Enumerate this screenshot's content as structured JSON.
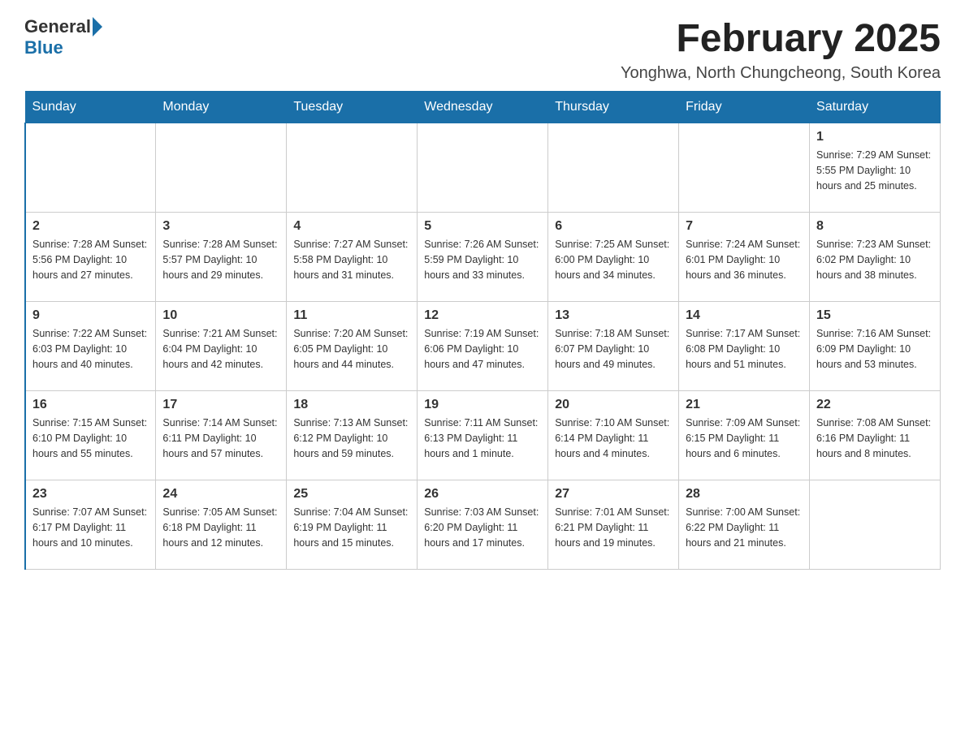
{
  "header": {
    "logo_general": "General",
    "logo_blue": "Blue",
    "title": "February 2025",
    "subtitle": "Yonghwa, North Chungcheong, South Korea"
  },
  "weekdays": [
    "Sunday",
    "Monday",
    "Tuesday",
    "Wednesday",
    "Thursday",
    "Friday",
    "Saturday"
  ],
  "weeks": [
    [
      {
        "day": "",
        "info": ""
      },
      {
        "day": "",
        "info": ""
      },
      {
        "day": "",
        "info": ""
      },
      {
        "day": "",
        "info": ""
      },
      {
        "day": "",
        "info": ""
      },
      {
        "day": "",
        "info": ""
      },
      {
        "day": "1",
        "info": "Sunrise: 7:29 AM\nSunset: 5:55 PM\nDaylight: 10 hours\nand 25 minutes."
      }
    ],
    [
      {
        "day": "2",
        "info": "Sunrise: 7:28 AM\nSunset: 5:56 PM\nDaylight: 10 hours\nand 27 minutes."
      },
      {
        "day": "3",
        "info": "Sunrise: 7:28 AM\nSunset: 5:57 PM\nDaylight: 10 hours\nand 29 minutes."
      },
      {
        "day": "4",
        "info": "Sunrise: 7:27 AM\nSunset: 5:58 PM\nDaylight: 10 hours\nand 31 minutes."
      },
      {
        "day": "5",
        "info": "Sunrise: 7:26 AM\nSunset: 5:59 PM\nDaylight: 10 hours\nand 33 minutes."
      },
      {
        "day": "6",
        "info": "Sunrise: 7:25 AM\nSunset: 6:00 PM\nDaylight: 10 hours\nand 34 minutes."
      },
      {
        "day": "7",
        "info": "Sunrise: 7:24 AM\nSunset: 6:01 PM\nDaylight: 10 hours\nand 36 minutes."
      },
      {
        "day": "8",
        "info": "Sunrise: 7:23 AM\nSunset: 6:02 PM\nDaylight: 10 hours\nand 38 minutes."
      }
    ],
    [
      {
        "day": "9",
        "info": "Sunrise: 7:22 AM\nSunset: 6:03 PM\nDaylight: 10 hours\nand 40 minutes."
      },
      {
        "day": "10",
        "info": "Sunrise: 7:21 AM\nSunset: 6:04 PM\nDaylight: 10 hours\nand 42 minutes."
      },
      {
        "day": "11",
        "info": "Sunrise: 7:20 AM\nSunset: 6:05 PM\nDaylight: 10 hours\nand 44 minutes."
      },
      {
        "day": "12",
        "info": "Sunrise: 7:19 AM\nSunset: 6:06 PM\nDaylight: 10 hours\nand 47 minutes."
      },
      {
        "day": "13",
        "info": "Sunrise: 7:18 AM\nSunset: 6:07 PM\nDaylight: 10 hours\nand 49 minutes."
      },
      {
        "day": "14",
        "info": "Sunrise: 7:17 AM\nSunset: 6:08 PM\nDaylight: 10 hours\nand 51 minutes."
      },
      {
        "day": "15",
        "info": "Sunrise: 7:16 AM\nSunset: 6:09 PM\nDaylight: 10 hours\nand 53 minutes."
      }
    ],
    [
      {
        "day": "16",
        "info": "Sunrise: 7:15 AM\nSunset: 6:10 PM\nDaylight: 10 hours\nand 55 minutes."
      },
      {
        "day": "17",
        "info": "Sunrise: 7:14 AM\nSunset: 6:11 PM\nDaylight: 10 hours\nand 57 minutes."
      },
      {
        "day": "18",
        "info": "Sunrise: 7:13 AM\nSunset: 6:12 PM\nDaylight: 10 hours\nand 59 minutes."
      },
      {
        "day": "19",
        "info": "Sunrise: 7:11 AM\nSunset: 6:13 PM\nDaylight: 11 hours\nand 1 minute."
      },
      {
        "day": "20",
        "info": "Sunrise: 7:10 AM\nSunset: 6:14 PM\nDaylight: 11 hours\nand 4 minutes."
      },
      {
        "day": "21",
        "info": "Sunrise: 7:09 AM\nSunset: 6:15 PM\nDaylight: 11 hours\nand 6 minutes."
      },
      {
        "day": "22",
        "info": "Sunrise: 7:08 AM\nSunset: 6:16 PM\nDaylight: 11 hours\nand 8 minutes."
      }
    ],
    [
      {
        "day": "23",
        "info": "Sunrise: 7:07 AM\nSunset: 6:17 PM\nDaylight: 11 hours\nand 10 minutes."
      },
      {
        "day": "24",
        "info": "Sunrise: 7:05 AM\nSunset: 6:18 PM\nDaylight: 11 hours\nand 12 minutes."
      },
      {
        "day": "25",
        "info": "Sunrise: 7:04 AM\nSunset: 6:19 PM\nDaylight: 11 hours\nand 15 minutes."
      },
      {
        "day": "26",
        "info": "Sunrise: 7:03 AM\nSunset: 6:20 PM\nDaylight: 11 hours\nand 17 minutes."
      },
      {
        "day": "27",
        "info": "Sunrise: 7:01 AM\nSunset: 6:21 PM\nDaylight: 11 hours\nand 19 minutes."
      },
      {
        "day": "28",
        "info": "Sunrise: 7:00 AM\nSunset: 6:22 PM\nDaylight: 11 hours\nand 21 minutes."
      },
      {
        "day": "",
        "info": ""
      }
    ]
  ]
}
